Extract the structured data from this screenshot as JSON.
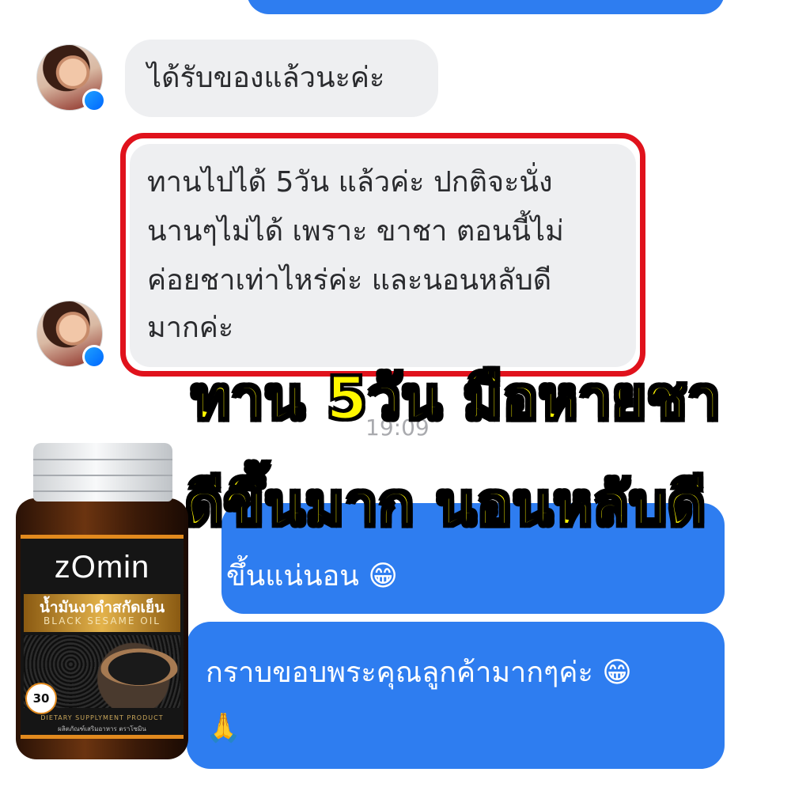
{
  "conversation": {
    "received_message": "ได้รับของแล้วนะค่ะ",
    "review_lines": [
      "ทานไปได้ 5วัน แล้วค่ะ ปกติจะนั่ง",
      "นานๆไม่ได้ เพราะ ขาชา ตอนนี้ไม่",
      "ค่อยชาเท่าไหร่ค่ะ และนอนหลับดี",
      "มากค่ะ"
    ],
    "timestamp": "19:09",
    "reply_partial": "ขึ้นแน่นอน 😁",
    "reply_thanks": "กราบขอบพระคุณลูกค้ามากๆค่ะ 😁",
    "reply_emoji": "🙏"
  },
  "overlay": {
    "line1": "ทาน 5วัน มือหายชา",
    "line2": "ดีขึ้นมาก นอนหลับดี"
  },
  "product": {
    "brand": "zOmin",
    "name_th": "น้ำมันงาดำสกัดเย็น",
    "name_en": "BLACK SESAME OIL",
    "count": "30",
    "footer_en": "DIETARY SUPPLYMENT PRODUCT",
    "footer_th": "ผลิตภัณฑ์เสริมอาหาร ตราโซมิน"
  },
  "icons": {
    "avatar": "user-avatar-icon",
    "messenger_badge": "messenger-icon"
  },
  "colors": {
    "outgoing_bubble": "#2e7df0",
    "incoming_bubble": "#eeeff1",
    "highlight_border": "#e0121c",
    "overlay_text": "#fff700"
  }
}
